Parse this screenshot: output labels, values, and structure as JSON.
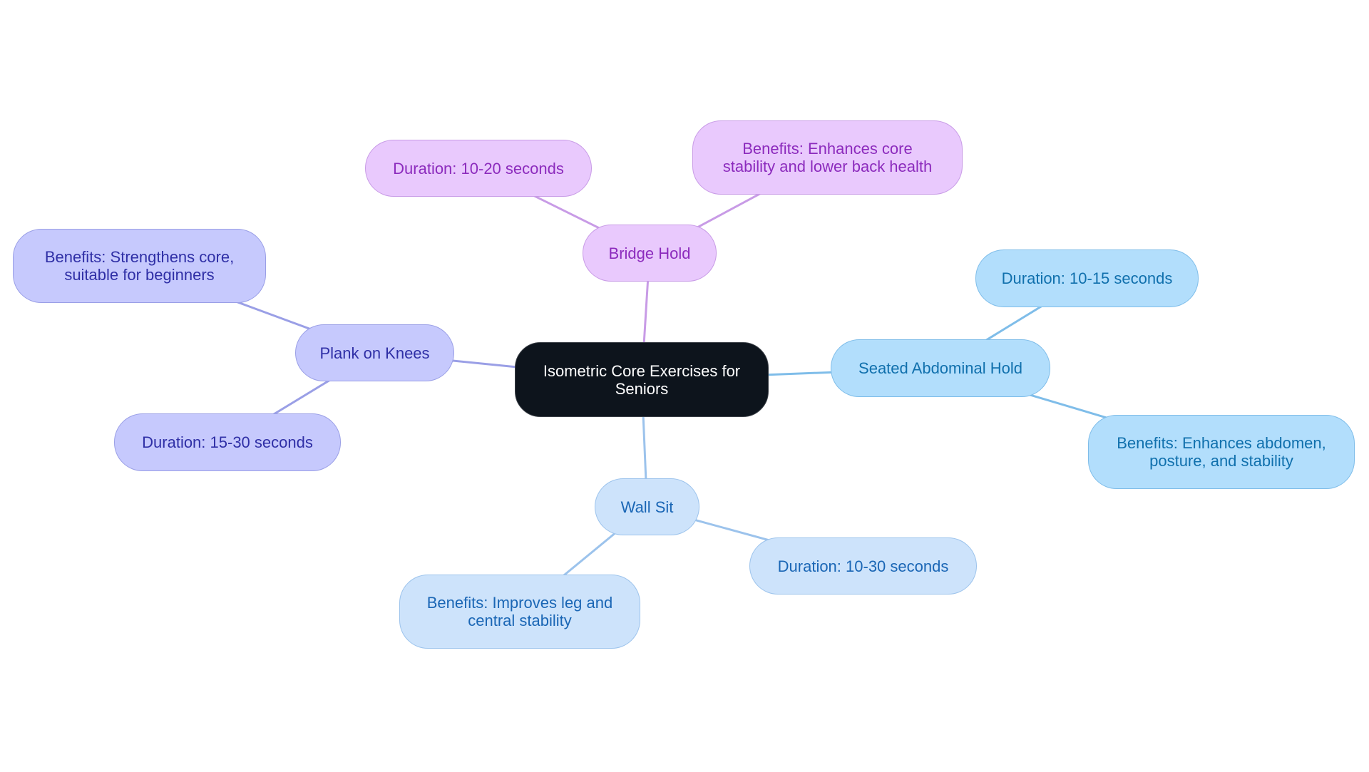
{
  "diagram": {
    "type": "mindmap",
    "root": {
      "id": "root",
      "label": "Isometric Core Exercises for Seniors",
      "color": "#0d141c"
    },
    "branches": [
      {
        "id": "bridge",
        "label": "Bridge Hold",
        "theme": "purple",
        "edge_color": "#c89be6",
        "children": [
          {
            "id": "bridge-duration",
            "label": "Duration: 10-20 seconds"
          },
          {
            "id": "bridge-benefits",
            "label": "Benefits: Enhances core stability and lower back health"
          }
        ]
      },
      {
        "id": "plank",
        "label": "Plank on Knees",
        "theme": "indigo",
        "edge_color": "#9a9fe6",
        "children": [
          {
            "id": "plank-benefits",
            "label": "Benefits: Strengthens core, suitable for beginners"
          },
          {
            "id": "plank-duration",
            "label": "Duration: 15-30 seconds"
          }
        ]
      },
      {
        "id": "seated",
        "label": "Seated Abdominal Hold",
        "theme": "sky",
        "edge_color": "#7fbde9",
        "children": [
          {
            "id": "seated-duration",
            "label": "Duration: 10-15 seconds"
          },
          {
            "id": "seated-benefits",
            "label": "Benefits: Enhances abdomen, posture, and stability"
          }
        ]
      },
      {
        "id": "wall",
        "label": "Wall Sit",
        "theme": "pale",
        "edge_color": "#9cc3ec",
        "children": [
          {
            "id": "wall-duration",
            "label": "Duration: 10-30 seconds"
          },
          {
            "id": "wall-benefits",
            "label": "Benefits: Improves leg and central stability"
          }
        ]
      }
    ]
  }
}
